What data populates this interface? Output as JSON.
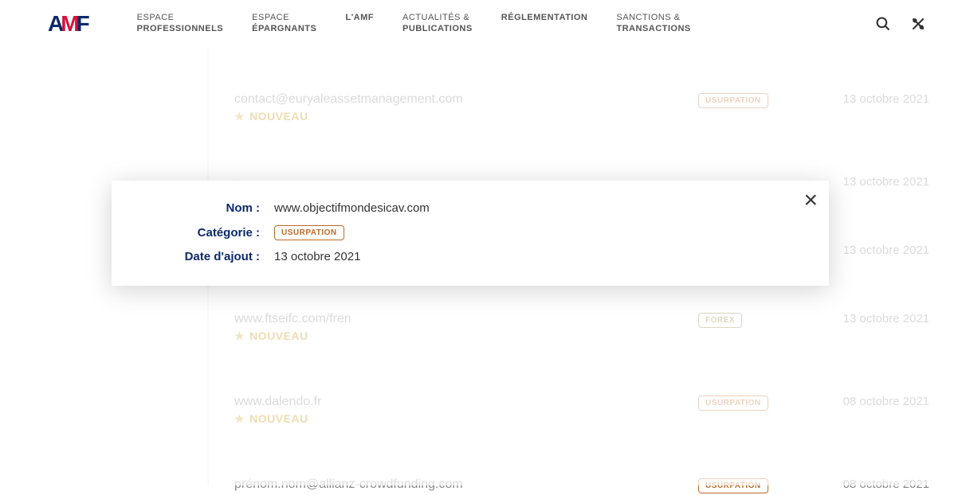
{
  "logo": {
    "a": "A",
    "m": "M",
    "f": "F"
  },
  "nav": [
    {
      "top": "ESPACE",
      "bot": "PROFESSIONNELS"
    },
    {
      "top": "ESPACE",
      "bot": "ÉPARGNANTS"
    },
    {
      "top": "",
      "bot": "L'AMF"
    },
    {
      "top": "ACTUALITÉS &",
      "bot": "PUBLICATIONS"
    },
    {
      "top": "",
      "bot": "RÉGLEMENTATION"
    },
    {
      "top": "SANCTIONS &",
      "bot": "TRANSACTIONS"
    }
  ],
  "badge_label": {
    "usurpation": "USURPATION",
    "forex": "FOREX"
  },
  "nouveau": "NOUVEAU",
  "rows": [
    {
      "name": "",
      "cat": "",
      "date": "",
      "partial_top": true
    },
    {
      "name": "contact@euryaleassetmanagement.com",
      "cat": "usurpation",
      "date": "13 octobre 2021"
    },
    {
      "name": "",
      "cat": "",
      "date": "13 octobre 2021",
      "obscured": true
    },
    {
      "name": "",
      "cat": "",
      "date": "13 octobre 2021",
      "obscured": true
    },
    {
      "name": "www.ftseifc.com/fren",
      "cat": "forex",
      "date": "13 octobre 2021"
    },
    {
      "name": "www.dalendo.fr",
      "cat": "usurpation",
      "date": "08 octobre 2021"
    },
    {
      "name": "prénom.nom@allianz-crowdfunding.com",
      "cat": "usurpation",
      "date": "08 octobre 2021",
      "partial_bottom": true
    }
  ],
  "modal": {
    "labels": {
      "nom": "Nom :",
      "cat": "Catégorie :",
      "date": "Date d'ajout :"
    },
    "nom": "www.objectifmondesicav.com",
    "cat": "usurpation",
    "date": "13 octobre 2021"
  }
}
